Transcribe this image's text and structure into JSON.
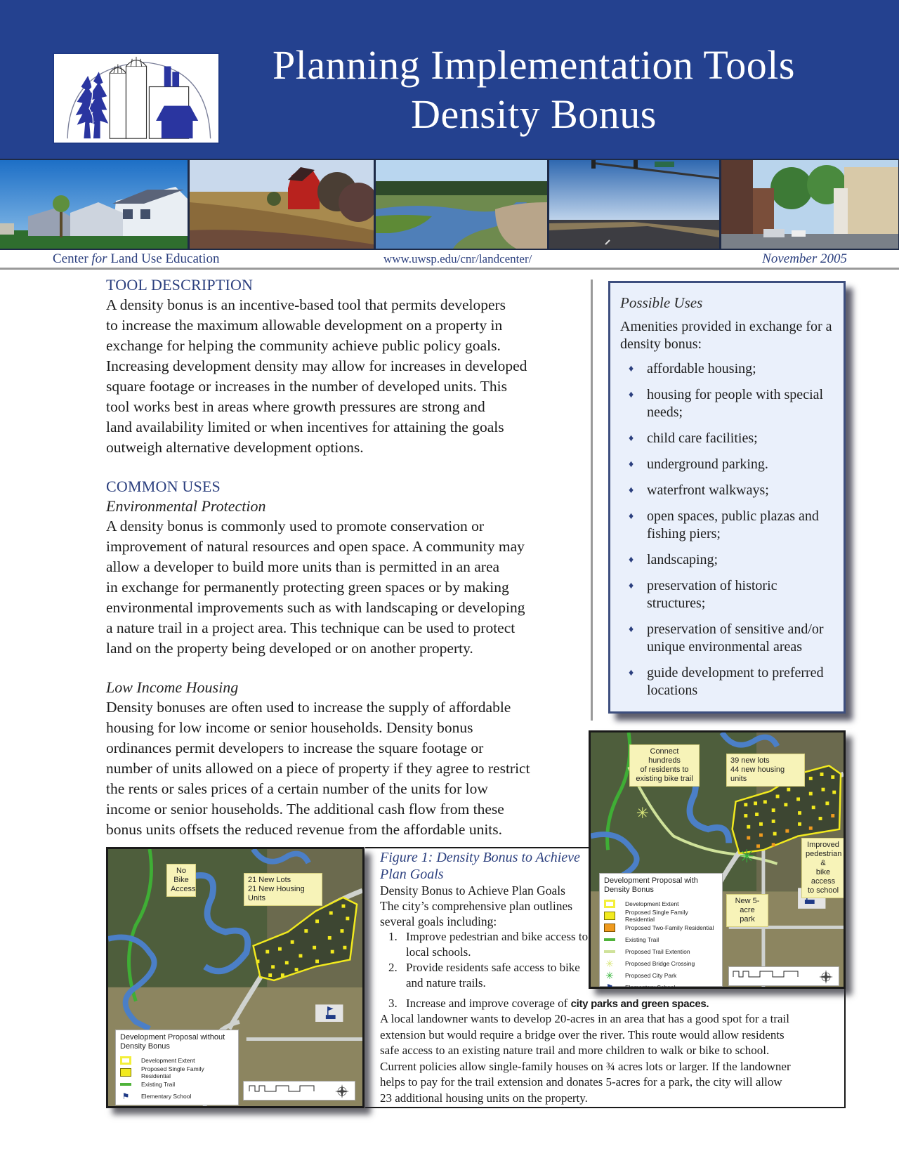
{
  "header": {
    "title_line1": "Planning Implementation Tools",
    "title_line2": "Density Bonus",
    "logo_alt": "Center for Land Use Education logo"
  },
  "photos": [
    {
      "name": "suburban-houses-photo"
    },
    {
      "name": "red-barn-field-photo"
    },
    {
      "name": "river-wetland-photo"
    },
    {
      "name": "highway-intersection-photo"
    },
    {
      "name": "main-street-town-photo"
    }
  ],
  "infobar": {
    "center_pre": "Center ",
    "center_for": "for",
    "center_post": " Land Use Education",
    "url": "www.uwsp.edu/cnr/landcenter/",
    "date": "November 2005"
  },
  "tool_description": {
    "heading": "TOOL DESCRIPTION",
    "body": "A density bonus is an incentive-based tool that permits developers\nto increase the maximum allowable development on a property in\nexchange for helping the community achieve public policy goals.\nIncreasing development density may allow for increases in developed\nsquare footage or increases in the number of developed units.  This\ntool works best in areas where growth pressures are strong and\nland availability limited or when incentives for attaining the goals\noutweigh alternative development options."
  },
  "common_uses": {
    "heading": "COMMON USES",
    "sections": [
      {
        "subheading": "Environmental Protection",
        "body": "A density bonus is commonly used to promote conservation or\nimprovement of natural resources and open space.  A community may\nallow a developer to build more units than is permitted in an area\nin exchange for permanently protecting green spaces or by making\nenvironmental improvements such as with landscaping or developing\na nature trail in a project area.  This technique can be used to protect\nland on the property being developed or on another property."
      },
      {
        "subheading": "Low Income Housing",
        "body": "Density bonuses are often used to increase the supply of affordable\nhousing for low income or senior households.  Density bonus\nordinances permit developers to increase the square footage or\nnumber of units allowed on a piece of property if they agree to restrict\nthe rents or sales prices of a certain number of the units for low\nincome or senior households. The additional cash flow from these\nbonus units offsets the reduced revenue from the affordable units."
      }
    ]
  },
  "possible_uses": {
    "title": "Possible Uses",
    "intro": "Amenities provided in exchange for a density bonus:",
    "bullet": "♦",
    "items": [
      "affordable housing;",
      "housing for people with special needs;",
      "child care facilities;",
      "underground parking.",
      "waterfront walkways;",
      "open spaces, public plazas and fishing piers;",
      "landscaping;",
      "preservation of historic structures;",
      "preservation of sensitive and/or unique environmental areas",
      "guide development to preferred locations"
    ]
  },
  "map_without": {
    "callouts": [
      "No Bike\nAccess",
      "21 New Lots\n21 New Housing Units"
    ],
    "legend_title": "Development Proposal without Density Bonus",
    "legend": [
      {
        "swatch": "extent",
        "label": "Development Extent"
      },
      {
        "swatch": "single",
        "label": "Proposed Single Family Residential"
      },
      {
        "swatch": "trail",
        "label": "Existing Trail"
      },
      {
        "swatch": "school",
        "label": "Elementary School"
      }
    ],
    "scale": {
      "unit": "Feet",
      "ticks": [
        "0",
        "230",
        "460",
        "640",
        "920"
      ]
    }
  },
  "map_with": {
    "callouts": [
      "Connect hundreds\nof residents to\nexisting bike trail",
      "39 new lots\n44 new housing units",
      "Improved\npedestrian &\nbike access\nto school",
      "New 5-acre\npark"
    ],
    "legend_title": "Development Proposal with Density Bonus",
    "legend": [
      {
        "swatch": "extent",
        "label": "Development Extent"
      },
      {
        "swatch": "single",
        "label": "Proposed Single Family Residential"
      },
      {
        "swatch": "two",
        "label": "Proposed Two-Family Residential"
      },
      {
        "swatch": "trail",
        "label": "Existing Trail"
      },
      {
        "swatch": "ptrail",
        "label": "Proposed Trail Extention"
      },
      {
        "swatch": "bridge",
        "label": "Proposed Bridge Crossing"
      },
      {
        "swatch": "park",
        "label": "Proposed City Park"
      },
      {
        "swatch": "school",
        "label": "Elementary School"
      }
    ],
    "scale": {
      "unit": "Feet",
      "ticks": [
        "0",
        "230",
        "460",
        "690",
        "920"
      ]
    }
  },
  "figure": {
    "title": "Figure 1:  Density Bonus to Achieve Plan Goals",
    "subtitle": "Density Bonus to Achieve Plan Goals",
    "intro": "The city’s comprehensive plan outlines several goals including:",
    "goals": [
      {
        "num": "1.",
        "text": "Improve pedestrian and bike access to local schools."
      },
      {
        "num": "2.",
        "text": "Provide residents safe access to bike and nature trails."
      },
      {
        "num": "3.",
        "text": "Increase and improve coverage of ",
        "bold": "city parks and green spaces."
      }
    ],
    "body": "A local landowner wants to develop 20-acres in an area that has a good spot for a trail\nextension but would require a bridge over the river. This route would allow residents\nsafe access to an existing nature trail and more children to walk or bike to school.\nCurrent policies allow single-family houses on ¾ acres lots or larger.  If the landowner\nhelps to pay for the trail extension and donates 5-acres for a park, the city will allow\n23 additional housing units on the property."
  },
  "colors": {
    "banner": "#24418f",
    "heading_blue": "#2b3f7e",
    "sidebar_bg": "#eaf0fb",
    "sidebar_border": "#3d4e7e"
  }
}
